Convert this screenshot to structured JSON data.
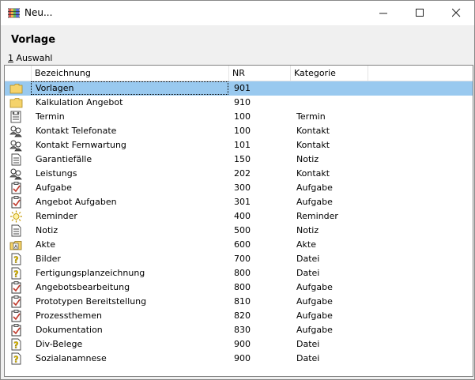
{
  "window": {
    "title": "Neu..."
  },
  "heading": "Vorlage",
  "tab": {
    "underline": "1",
    "label": " Auswahl"
  },
  "columns": {
    "name": "Bezeichnung",
    "nr": "NR",
    "kategorie": "Kategorie"
  },
  "rows": [
    {
      "icon": "folder",
      "name": "Vorlagen",
      "nr": "901",
      "kategorie": ""
    },
    {
      "icon": "folder",
      "name": "Kalkulation Angebot",
      "nr": "910",
      "kategorie": ""
    },
    {
      "icon": "appointment",
      "name": "Termin",
      "nr": "100",
      "kategorie": "Termin"
    },
    {
      "icon": "contact",
      "name": "Kontakt Telefonate",
      "nr": "100",
      "kategorie": "Kontakt"
    },
    {
      "icon": "contact",
      "name": "Kontakt Fernwartung",
      "nr": "101",
      "kategorie": "Kontakt"
    },
    {
      "icon": "note",
      "name": "Garantiefälle",
      "nr": "150",
      "kategorie": "Notiz"
    },
    {
      "icon": "contact",
      "name": "Leistungs",
      "nr": "202",
      "kategorie": "Kontakt"
    },
    {
      "icon": "task",
      "name": "Aufgabe",
      "nr": "300",
      "kategorie": "Aufgabe"
    },
    {
      "icon": "task",
      "name": "Angebot Aufgaben",
      "nr": "301",
      "kategorie": "Aufgabe"
    },
    {
      "icon": "reminder",
      "name": "Reminder",
      "nr": "400",
      "kategorie": "Reminder"
    },
    {
      "icon": "note",
      "name": "Notiz",
      "nr": "500",
      "kategorie": "Notiz"
    },
    {
      "icon": "file-folder",
      "name": "Akte",
      "nr": "600",
      "kategorie": "Akte"
    },
    {
      "icon": "file-unknown",
      "name": "Bilder",
      "nr": "700",
      "kategorie": "Datei"
    },
    {
      "icon": "file-unknown",
      "name": "Fertigungsplanzeichnung",
      "nr": "800",
      "kategorie": "Datei"
    },
    {
      "icon": "task",
      "name": "Angebotsbearbeitung",
      "nr": "800",
      "kategorie": "Aufgabe"
    },
    {
      "icon": "task",
      "name": "Prototypen Bereitstellung",
      "nr": "810",
      "kategorie": "Aufgabe"
    },
    {
      "icon": "task",
      "name": "Prozessthemen",
      "nr": "820",
      "kategorie": "Aufgabe"
    },
    {
      "icon": "task",
      "name": "Dokumentation",
      "nr": "830",
      "kategorie": "Aufgabe"
    },
    {
      "icon": "file-unknown",
      "name": "Div-Belege",
      "nr": "900",
      "kategorie": "Datei"
    },
    {
      "icon": "file-unknown",
      "name": "Sozialanamnese",
      "nr": "900",
      "kategorie": "Datei"
    }
  ],
  "selected_index": 0,
  "colors": {
    "selection": "#99c9ef",
    "folder": "#f5d36b",
    "accent_red": "#c0392b"
  }
}
